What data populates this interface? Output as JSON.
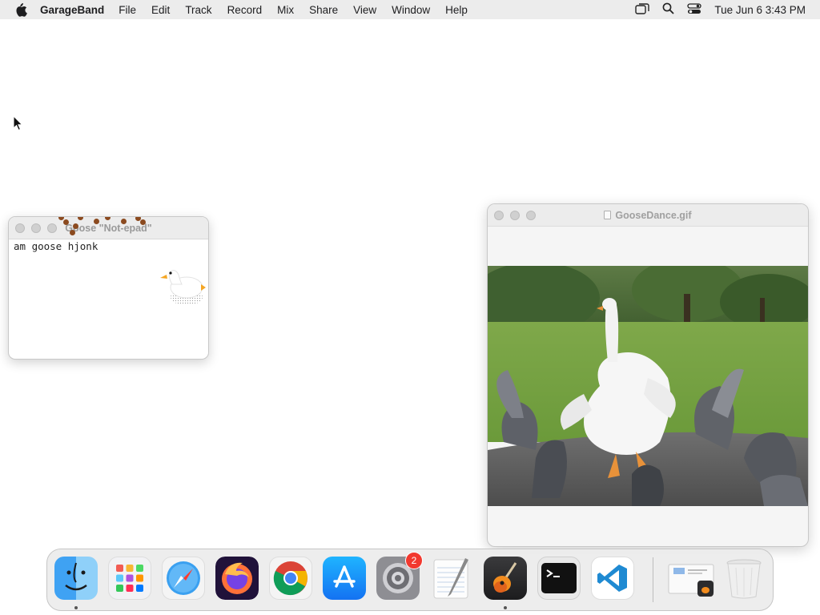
{
  "menubar": {
    "app_name": "GarageBand",
    "items": [
      "File",
      "Edit",
      "Track",
      "Record",
      "Mix",
      "Share",
      "View",
      "Window",
      "Help"
    ],
    "clock": "Tue Jun 6  3:43 PM",
    "icons": [
      "apple-icon",
      "screen-mirroring-icon",
      "search-icon",
      "control-center-icon"
    ]
  },
  "notepad": {
    "title": "Goose \"Not-epad\"",
    "text": "am goose hjonk"
  },
  "gif_window": {
    "title": "GooseDance.gif"
  },
  "dock": {
    "apps": [
      {
        "name": "Finder",
        "icon": "finder-icon",
        "running": true
      },
      {
        "name": "Launchpad",
        "icon": "launchpad-icon",
        "running": false
      },
      {
        "name": "Safari",
        "icon": "safari-icon",
        "running": false
      },
      {
        "name": "Firefox",
        "icon": "firefox-icon",
        "running": false
      },
      {
        "name": "Chrome",
        "icon": "chrome-icon",
        "running": false
      },
      {
        "name": "App Store",
        "icon": "app-store-icon",
        "running": false
      },
      {
        "name": "System Settings",
        "icon": "system-settings-icon",
        "running": false,
        "badge": "2"
      },
      {
        "name": "TextEdit",
        "icon": "textedit-icon",
        "running": false
      },
      {
        "name": "GarageBand",
        "icon": "garageband-icon",
        "running": true
      },
      {
        "name": "Terminal",
        "icon": "terminal-icon",
        "running": false
      },
      {
        "name": "VS Code",
        "icon": "vscode-icon",
        "running": false
      },
      {
        "name": "Downloads",
        "icon": "downloads-stack-icon",
        "running": false
      },
      {
        "name": "Trash",
        "icon": "trash-icon",
        "running": false
      }
    ]
  },
  "colors": {
    "menubar_bg": "#ececec",
    "dock_bg": "#ececec",
    "badge": "#f2392f",
    "mud": "#8b4a1f"
  }
}
